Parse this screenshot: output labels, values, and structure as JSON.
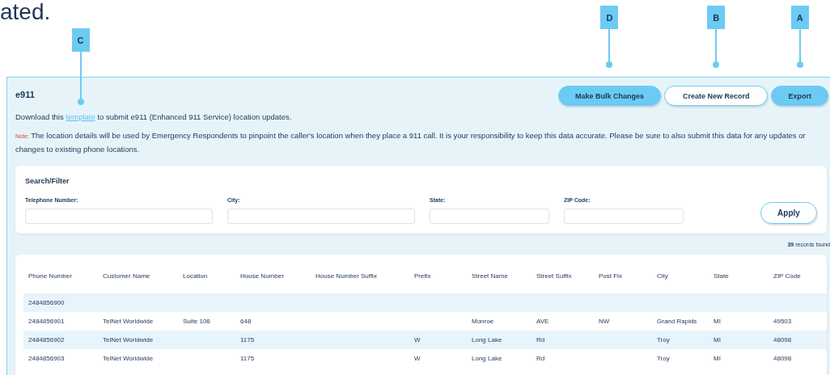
{
  "heading_fragment": "ated.",
  "panel": {
    "title": "e911",
    "actions": [
      {
        "label": "Make Bulk Changes",
        "kind": "filled",
        "callout": "D"
      },
      {
        "label": "Create New Record",
        "kind": "outline",
        "callout": "B"
      },
      {
        "label": "Export",
        "kind": "filled",
        "callout": "A"
      }
    ],
    "intro": {
      "before": "Download this ",
      "link": "template",
      "link_callout": "C",
      "after": " to submit e911 (Enhanced 911 Service) location updates."
    },
    "note": {
      "label": "Note:",
      "text": "The location details will be used by Emergency Respondents to pinpoint the caller's location when they place a 911 call. It is your responsibility to keep this data accurate. Please be sure to also submit this data for any updates or changes to existing phone locations."
    }
  },
  "filter": {
    "title": "Search/Filter",
    "fields": [
      {
        "label": "Telephone Number:"
      },
      {
        "label": "City:"
      },
      {
        "label": "State:"
      },
      {
        "label": "ZIP Code:"
      }
    ],
    "apply": "Apply"
  },
  "records_found": {
    "count": "39",
    "text": " records found"
  },
  "table": {
    "columns": [
      "Phone Number",
      "Customer Name",
      "Location",
      "House Number",
      "House Number Suffix",
      "Prefix",
      "Street Name",
      "Street Suffix",
      "Post Fix",
      "City",
      "State",
      "ZIP Code"
    ],
    "rows": [
      [
        "2484856900",
        "",
        "",
        "",
        "",
        "",
        "",
        "",
        "",
        "",
        "",
        ""
      ],
      [
        "2484856901",
        "TelNet Worldwide",
        "Suite 106",
        "648",
        "",
        "",
        "Monroe",
        "AVE",
        "NW",
        "Grand Rapids",
        "MI",
        "49503"
      ],
      [
        "2484856902",
        "TelNet Worldwide",
        "",
        "1175",
        "",
        "W",
        "Long Lake",
        "Rd",
        "",
        "Troy",
        "MI",
        "48098"
      ],
      [
        "2484856903",
        "TelNet Worldwide",
        "",
        "1175",
        "",
        "W",
        "Long Lake",
        "Rd",
        "",
        "Troy",
        "MI",
        "48098"
      ]
    ]
  }
}
